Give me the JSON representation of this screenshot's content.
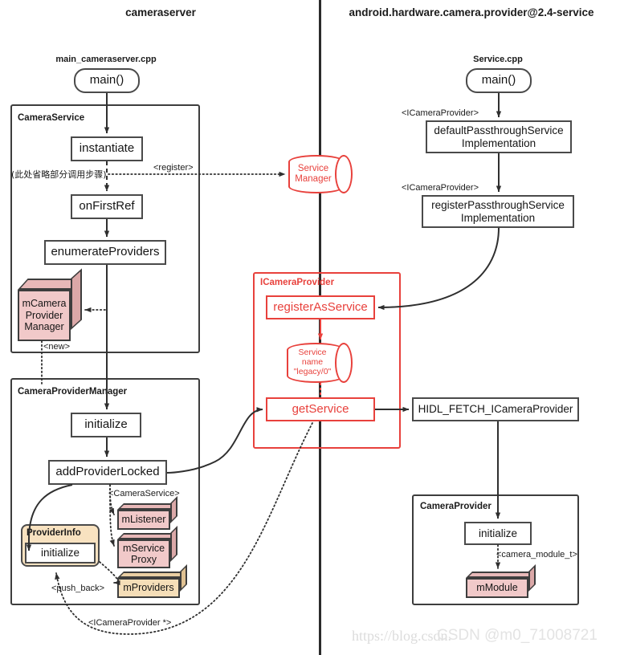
{
  "columns": [
    {
      "title": "cameraserver"
    },
    {
      "title": "android.hardware.camera.provider@2.4-service"
    }
  ],
  "file_titles": {
    "left": "main_cameraserver.cpp",
    "right": "Service.cpp"
  },
  "groups": {
    "camera_service": "CameraService",
    "camera_provider_manager": "CameraProviderManager",
    "icamera_provider": "ICameraProvider",
    "camera_provider": "CameraProvider"
  },
  "nodes": {
    "left_main": "main()",
    "instantiate": "instantiate",
    "on_first_ref": "onFirstRef",
    "enumerate_providers": "enumerateProviders",
    "cpm_initialize": "initialize",
    "add_provider_locked": "addProviderLocked",
    "provider_info_title": "ProviderInfo",
    "provider_info_initialize": "initialize",
    "register_as_service": "registerAsService",
    "get_service": "getService",
    "right_main": "main()",
    "default_passthrough": "defaultPassthroughService\nImplementation",
    "register_passthrough": "registerPassthroughService\nImplementation",
    "hidl_fetch": "HIDL_FETCH_ICameraProvider",
    "cp_initialize": "initialize"
  },
  "components": {
    "m_camera_provider_manager": "mCamera\nProvider\nManager",
    "m_listener": "mListener",
    "m_service_proxy": "mService\nProxy",
    "m_providers": "mProviders",
    "m_module": "mModule"
  },
  "cylinders": {
    "service_manager": "Service\nManager",
    "service_name": "Service\nname\n\"legacy/0\""
  },
  "edge_labels": {
    "omitted_steps": "(此处省略部分调用步骤)",
    "register": "<register>",
    "new": "<new>",
    "camera_service": "<CameraService>",
    "push_back": "<push_back>",
    "icamera_provider_ptr": "<ICameraProvider *>",
    "icamera_provider_1": "<ICameraProvider>",
    "icamera_provider_2": "<ICameraProvider>",
    "camera_module_t": "<camera_module_t>"
  },
  "watermark": {
    "url": "https://blog.csdn.",
    "tag": "CSDN @m0_71008721"
  },
  "colors": {
    "accent_red": "#e8413c",
    "stroke": "#3d3d3d",
    "component_pink": "#f1c9c9",
    "component_tan": "#f5deb8",
    "group_tan": "#f8e2c0"
  }
}
